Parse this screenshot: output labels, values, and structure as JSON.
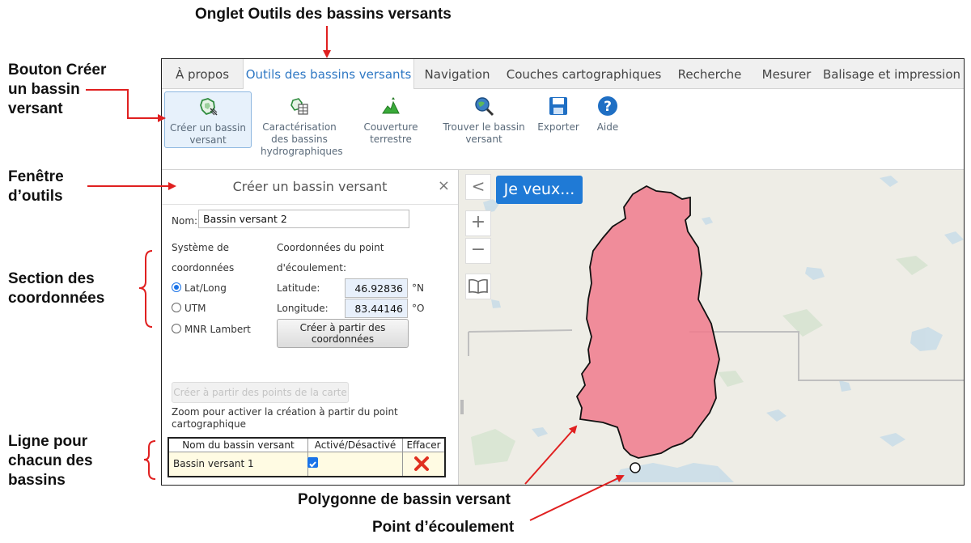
{
  "annotations": {
    "tab_label": "Onglet Outils des bassins versants",
    "create_button": [
      "Bouton Créer",
      "un bassin",
      "versant"
    ],
    "tool_window": [
      "Fenêtre",
      "d’outils"
    ],
    "coord_section": [
      "Section des",
      "coordonnées"
    ],
    "row_label": [
      "Ligne pour",
      "chacun des",
      "bassins"
    ],
    "polygon": "Polygonne de bassin versant",
    "outlet": "Point d’écoulement"
  },
  "tabs": [
    "À propos",
    "Outils des bassins versants",
    "Navigation",
    "Couches cartographiques",
    "Recherche",
    "Mesurer",
    "Balisage et impression"
  ],
  "active_tab": "Outils des bassins versants",
  "ribbon": [
    {
      "icon": "create-watershed-icon",
      "lines": [
        "Créer un bassin",
        "versant"
      ]
    },
    {
      "icon": "characterization-icon",
      "lines": [
        "Caractérisation",
        "des bassins",
        "hydrographiques"
      ]
    },
    {
      "icon": "land-cover-icon",
      "lines": [
        "Couverture",
        "terrestre"
      ]
    },
    {
      "icon": "find-watershed-icon",
      "lines": [
        "Trouver le bassin",
        "versant"
      ]
    },
    {
      "icon": "export-icon",
      "lines": [
        "Exporter"
      ]
    },
    {
      "icon": "help-icon",
      "lines": [
        "Aide"
      ]
    }
  ],
  "panel": {
    "title": "Créer un bassin versant",
    "close": "×",
    "name_label": "Nom:",
    "name_value": "Bassin versant 2",
    "coord_system_label": [
      "Système de",
      "coordonnées"
    ],
    "coord_options": [
      "Lat/Long",
      "UTM",
      "MNR Lambert"
    ],
    "selected_option": "Lat/Long",
    "outlet_label": [
      "Coordonnées du point",
      "d'écoulement:"
    ],
    "latitude_label": "Latitude:",
    "latitude_value": "46.92836",
    "latitude_unit": "°N",
    "longitude_label": "Longitude:",
    "longitude_value": "83.44146",
    "longitude_unit": "°O",
    "create_from_coords": [
      "Créer à partir des",
      "coordonnées"
    ],
    "create_from_map": "Créer à partir des points de la carte",
    "zoom_note": [
      "Zoom pour activer la création à partir du point",
      "cartographique"
    ],
    "table": {
      "headers": [
        "Nom du bassin versant",
        "Activé/Désactivé",
        "Effacer"
      ],
      "rows": [
        {
          "name": "Bassin versant 1",
          "active": true
        }
      ]
    }
  },
  "map": {
    "collapse": "<",
    "zoom_in": "+",
    "zoom_out": "−",
    "i_want": "Je veux...",
    "watershed_color": "#f07a8c"
  },
  "colors": {
    "accent": "#2f78c4",
    "annotation_arrow": "#e02020",
    "delete": "#e03020"
  }
}
